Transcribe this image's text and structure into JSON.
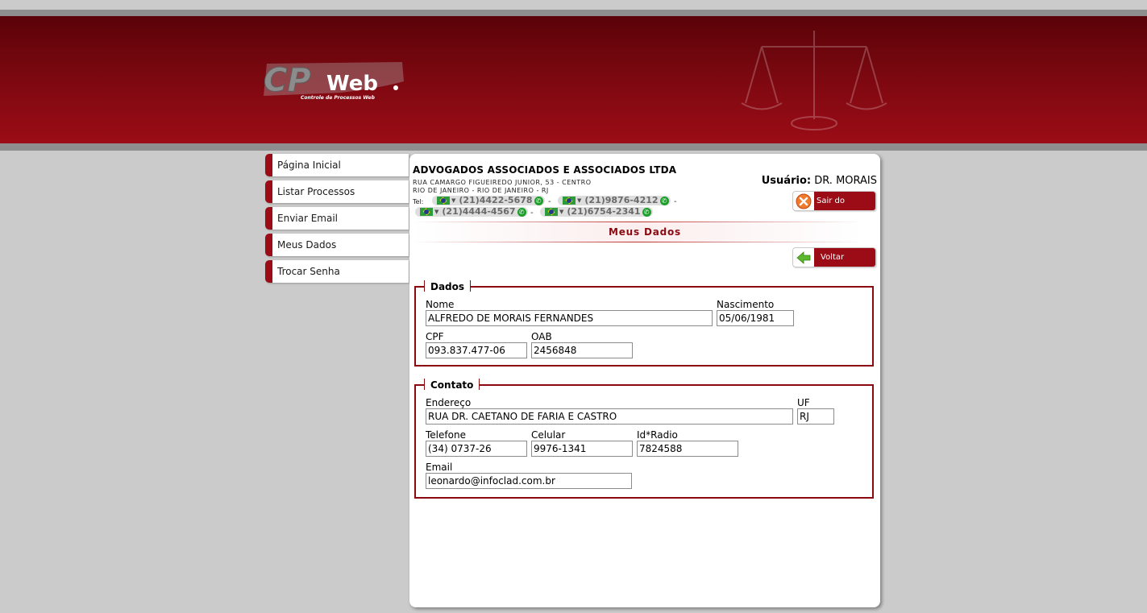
{
  "brand": {
    "logo_main": "CP",
    "logo_web": "Web",
    "logo_sub": "Controle de Processos Web"
  },
  "menu": [
    {
      "label": "Página Inicial"
    },
    {
      "label": "Listar Processos"
    },
    {
      "label": "Enviar Email"
    },
    {
      "label": "Meus Dados"
    },
    {
      "label": "Trocar Senha"
    }
  ],
  "header": {
    "company": "ADVOGADOS ASSOCIADOS E ASSOCIADOS LTDA",
    "address_line1": "RUA CAMARGO FIGUEIREDO JUNIOR, 53 - CENTRO",
    "address_line2": "RIO DE JANEIRO - RIO DE JANEIRO - RJ",
    "tel_label": "Tel:",
    "phones": [
      "(21)4422-5678",
      "(21)9876-4212",
      "(21)4444-4567",
      "(21)6754-2341"
    ],
    "separator": "-",
    "user_label": "Usuário:",
    "user_name": "DR. MORAIS",
    "exit_label": "Sair do Sistema"
  },
  "page": {
    "title": "Meus Dados",
    "back_label": "Voltar"
  },
  "dados": {
    "legend": "Dados",
    "nome_label": "Nome",
    "nome": "ALFREDO DE MORAIS FERNANDES",
    "nascimento_label": "Nascimento",
    "nascimento": "05/06/1981",
    "cpf_label": "CPF",
    "cpf": "093.837.477-06",
    "oab_label": "OAB",
    "oab": "2456848"
  },
  "contato": {
    "legend": "Contato",
    "endereco_label": "Endereço",
    "endereco": "RUA DR. CAETANO DE FARIA E CASTRO",
    "uf_label": "UF",
    "uf": "RJ",
    "telefone_label": "Telefone",
    "telefone": "(34) 0737-26",
    "celular_label": "Celular",
    "celular": "9976-1341",
    "idradio_label": "Id*Radio",
    "idradio": "7824588",
    "email_label": "Email",
    "email": "leonardo@infoclad.com.br"
  },
  "colors": {
    "brand_red": "#9b0c16",
    "banner_dark": "#5a0208",
    "border_red": "#8b0a12"
  },
  "icons": {
    "exit": "close-circle-icon",
    "back": "arrow-left-icon",
    "phone": "phone-icon",
    "flag": "brazil-flag-icon"
  }
}
